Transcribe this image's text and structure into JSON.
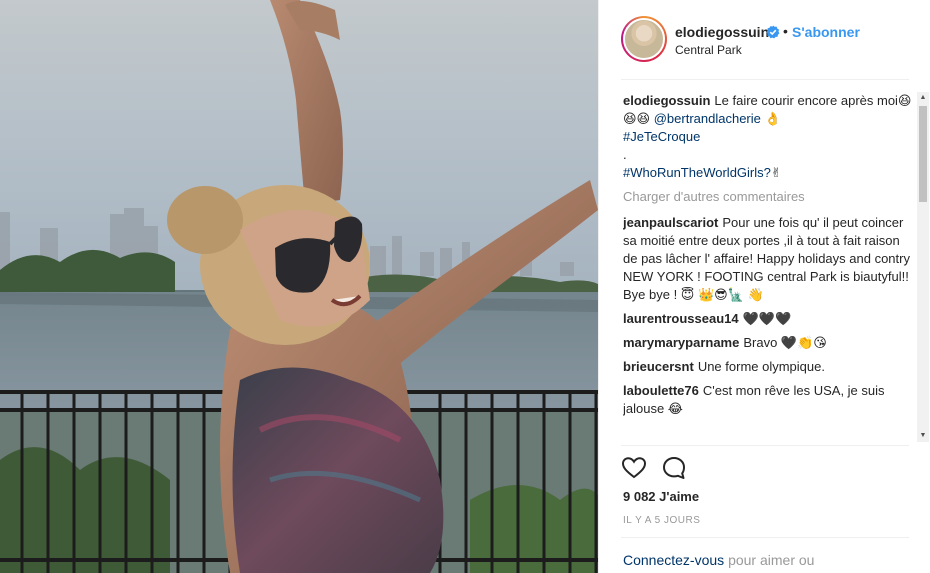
{
  "post": {
    "username": "elodiegossuin",
    "verified": true,
    "separator": "•",
    "follow_label": "S'abonner",
    "location": "Central Park"
  },
  "caption": {
    "user": "elodiegossuin",
    "text": "Le faire courir encore après moi😆😆😆",
    "mention": "@bertrandlacherie",
    "emoji_after_mention": "👌",
    "hashtag1": "#JeTeCroque",
    "dot_line": ".",
    "hashtag2": "#WhoRunTheWorldGirls?",
    "emoji_after_hashtag2": "✌"
  },
  "load_more": "Charger d'autres commentaires",
  "comments": [
    {
      "user": "jeanpaulscariot",
      "text": "Pour une fois qu' il peut coincer sa moitié entre deux portes ,il à tout à fait raison de pas lâcher l' affaire! Happy holidays and contry NEW YORK ! FOOTING central Park is biautyful!! Bye bye ! 😇 👑😎🗽 👋"
    },
    {
      "user": "laurentrousseau14",
      "text": "🖤🖤🖤"
    },
    {
      "user": "marymaryparname",
      "text": "Bravo 🖤👏😘"
    },
    {
      "user": "brieucersnt",
      "text": "Une forme olympique."
    },
    {
      "user": "laboulette76",
      "text": "C'est mon rêve les USA, je suis jalouse 😂"
    }
  ],
  "actions": {
    "like_icon": "heart-icon",
    "comment_icon": "speech-bubble-icon"
  },
  "likes": "9 082 J'aime",
  "timestamp": "IL Y A 5 JOURS",
  "login_prompt": {
    "link": "Connectez-vous",
    "rest": "pour aimer ou"
  },
  "colors": {
    "link_blue": "#3897f0",
    "mention_navy": "#003569",
    "muted_gray": "#999999",
    "text": "#262626"
  }
}
